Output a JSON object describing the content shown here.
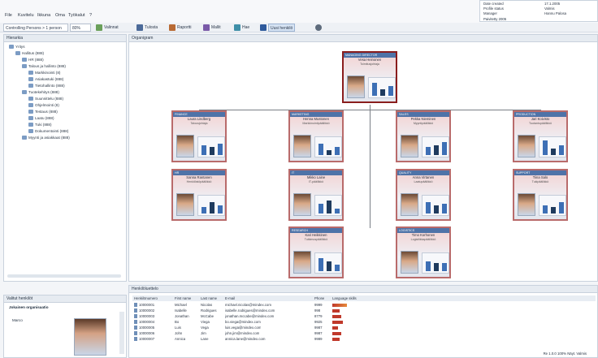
{
  "menubar": {
    "items": [
      "File",
      "Kuvitelu",
      "Ikkuna",
      "Oma",
      "Työkalut",
      "?"
    ]
  },
  "corner_info": {
    "rows": [
      {
        "label": "Date created",
        "value": "17.1.2005"
      },
      {
        "label": "Profile status",
        "value": "Valmis"
      },
      {
        "label": "Manager",
        "value": "Hannu Palosa"
      }
    ],
    "footer": "Paivitetty 2005"
  },
  "toolbar": {
    "controller_select": "Controlling Persons > 1 person",
    "zoom_select": "80%",
    "items": [
      "Valinnat",
      "Tulosta",
      "Raportti",
      "Mallit",
      "Hae",
      "Uusi henkilö"
    ]
  },
  "left_panel": {
    "title": "Hierarkia",
    "tree": [
      {
        "label": "Yritys",
        "level": 0
      },
      {
        "label": "Hallitus (888)",
        "level": 1
      },
      {
        "label": "HR (888)",
        "level": 2
      },
      {
        "label": "Talous ja hallinto (888)",
        "level": 2
      },
      {
        "label": "Markkinointi (8)",
        "level": 3
      },
      {
        "label": "Asiakastuki (888)",
        "level": 3
      },
      {
        "label": "Tietohallinto (888)",
        "level": 3
      },
      {
        "label": "Tuotekehitys (888)",
        "level": 2
      },
      {
        "label": "Suunnittelu (888)",
        "level": 3
      },
      {
        "label": "Ohjelmointi (8)",
        "level": 3
      },
      {
        "label": "Testaus (888)",
        "level": 3
      },
      {
        "label": "Laatu (888)",
        "level": 3
      },
      {
        "label": "Tuki (888)",
        "level": 3
      },
      {
        "label": "Dokumentointi (888)",
        "level": 3
      },
      {
        "label": "Myynti ja asiakkaat (888)",
        "level": 2
      }
    ]
  },
  "main_panel": {
    "title": "Organigram"
  },
  "cards": [
    {
      "id": "c0",
      "header": "MANAGING DIRECTOR",
      "name": "Vesa Heinonen",
      "title": "Toimitusjohtaja",
      "bars": [
        0.8,
        0.4,
        0.6
      ]
    },
    {
      "id": "c1",
      "header": "FINANCE",
      "name": "Laura Lindberg",
      "title": "Talousjohtaja",
      "bars": [
        0.6,
        0.5,
        0.7
      ]
    },
    {
      "id": "c2",
      "header": "MARKETING",
      "name": "Henna Mustonen",
      "title": "Markkinointipäällikkö",
      "bars": [
        0.7,
        0.3,
        0.5
      ]
    },
    {
      "id": "c3",
      "header": "SALES",
      "name": "Pekka Nieminen",
      "title": "Myyntipäällikkö",
      "bars": [
        0.5,
        0.6,
        0.8
      ]
    },
    {
      "id": "c4",
      "header": "PRODUCTION",
      "name": "Jari Koivisto",
      "title": "Tuotantopäällikkö",
      "bars": [
        0.9,
        0.4,
        0.6
      ]
    },
    {
      "id": "c5",
      "header": "HR",
      "name": "Sanna Rantanen",
      "title": "Henkilöstöpäällikkö",
      "bars": [
        0.4,
        0.7,
        0.5
      ]
    },
    {
      "id": "c6",
      "header": "IT",
      "name": "Mikko Laine",
      "title": "IT-päällikkö",
      "bars": [
        0.6,
        0.8,
        0.3
      ]
    },
    {
      "id": "c7",
      "header": "QUALITY",
      "name": "Anna Virtanen",
      "title": "Laatupäällikkö",
      "bars": [
        0.7,
        0.5,
        0.6
      ]
    },
    {
      "id": "c8",
      "header": "SUPPORT",
      "name": "Tiina Salo",
      "title": "Tukipäällikkö",
      "bars": [
        0.5,
        0.4,
        0.7
      ]
    },
    {
      "id": "c9",
      "header": "RESEARCH",
      "name": "Kari Heikkinen",
      "title": "Tutkimuspäällikkö",
      "bars": [
        0.8,
        0.6,
        0.4
      ]
    },
    {
      "id": "c10",
      "header": "LOGISTICS",
      "name": "Timo Korhonen",
      "title": "Logistiikkapäällikkö",
      "bars": [
        0.6,
        0.5,
        0.5
      ]
    }
  ],
  "bottom_left": {
    "title": "Valitut henkilöt",
    "person_label": "Jokainen organisaatio",
    "name": "Marco",
    "items": [
      "",
      "",
      ""
    ]
  },
  "bottom_right": {
    "title": "Henkilöluettelo",
    "columns": [
      "Henkilönumero",
      "First name",
      "Last name",
      "E-mail",
      "Phone",
      "Language skills"
    ],
    "rows": [
      {
        "id": "10000001",
        "first": "Michael",
        "last": "Nicolas",
        "email": "michael.nicolas@mindex.com",
        "phone": "9999",
        "skill": 0.8
      },
      {
        "id": "10000002",
        "first": "Isabelle",
        "last": "Rodrigues",
        "email": "isabelle.rodrigues@mindex.com",
        "phone": "998",
        "skill": 0.4
      },
      {
        "id": "10000003",
        "first": "Jonathan",
        "last": "McCabe",
        "email": "jonathan.mccabe@mindex.com",
        "phone": "8779",
        "skill": 0.5
      },
      {
        "id": "10000004",
        "first": "Bo",
        "last": "Viega",
        "email": "bo.viega@mindex.com",
        "phone": "9925",
        "skill": 0.6
      },
      {
        "id": "10000005",
        "first": "Luis",
        "last": "Vega",
        "email": "luis.vega@mindex.com",
        "phone": "9987",
        "skill": 0.3
      },
      {
        "id": "10000006",
        "first": "John",
        "last": "Jim",
        "email": "john.jim@mindex.com",
        "phone": "9987",
        "skill": 0.5
      },
      {
        "id": "10000007",
        "first": "Annica",
        "last": "Lane",
        "email": "annica.lane@mindex.com",
        "phone": "9989",
        "skill": 0.4
      }
    ]
  },
  "status": {
    "text": "Re 1.0.0  100%  Näyt. Valmis"
  },
  "colors": {
    "card_border": "#b96b6b",
    "card_header": "#4f73a8",
    "bar_blue": "#3d6fb5",
    "bar_dark": "#1f3b5e",
    "lang_red": "#c0392b",
    "lang_orange": "#e68a3c"
  }
}
